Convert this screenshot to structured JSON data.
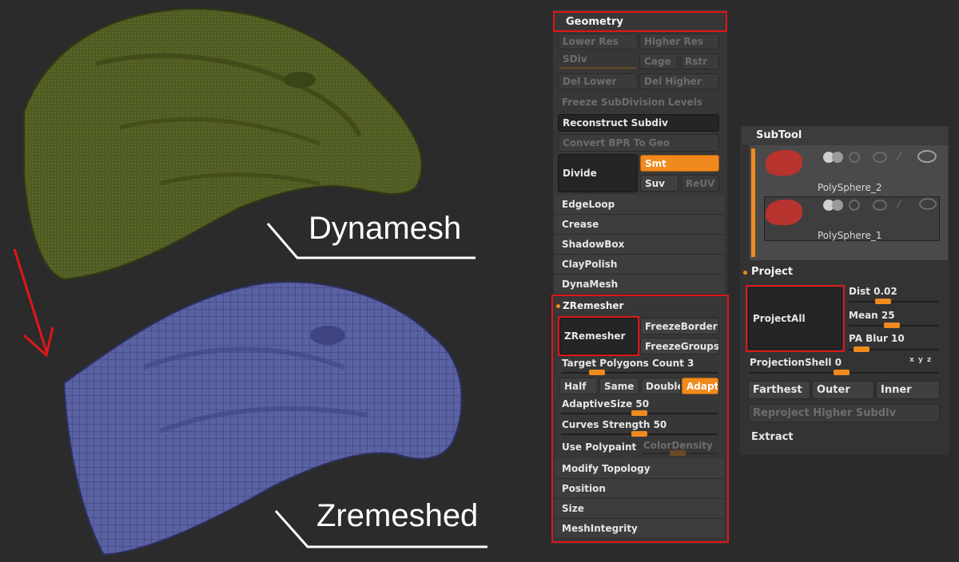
{
  "labels": {
    "dynamesh": "Dynamesh",
    "zremeshed": "Zremeshed"
  },
  "geometry": {
    "header": "Geometry",
    "lower_res": "Lower Res",
    "higher_res": "Higher Res",
    "sdiv": "SDiv",
    "cage": "Cage",
    "rstr": "Rstr",
    "del_lower": "Del Lower",
    "del_higher": "Del Higher",
    "freeze_subdivision": "Freeze SubDivision Levels",
    "reconstruct_subdiv": "Reconstruct Subdiv",
    "convert_bpr": "Convert BPR To Geo",
    "divide": "Divide",
    "smt": "Smt",
    "suv": "Suv",
    "reuv": "ReUV",
    "rows": [
      "EdgeLoop",
      "Crease",
      "ShadowBox",
      "ClayPolish",
      "DynaMesh"
    ]
  },
  "zremesher": {
    "header": "ZRemesher",
    "button": "ZRemesher",
    "freeze_border": "FreezeBorder",
    "freeze_groups": "FreezeGroups",
    "target_polygons": "Target Polygons Count 3",
    "target_polygons_value": 0.2,
    "half": "Half",
    "same": "Same",
    "double": "Double",
    "adapt": "Adapt",
    "adaptive_size": "AdaptiveSize 50",
    "adaptive_size_value": 0.5,
    "curves_strength": "Curves Strength 50",
    "curves_strength_value": 0.5,
    "use_polypaint": "Use Polypaint",
    "color_density": "ColorDensity",
    "rows": [
      "Modify Topology",
      "Position",
      "Size",
      "MeshIntegrity"
    ]
  },
  "subtool": {
    "header": "SubTool",
    "items": [
      "PolySphere_2",
      "PolySphere_1"
    ]
  },
  "project": {
    "header": "Project",
    "project_all": "ProjectAll",
    "dist": "Dist 0.02",
    "mean": "Mean 25",
    "pa_blur": "PA Blur 10",
    "projection_shell": "ProjectionShell 0",
    "xyz": "x y z",
    "farthest": "Farthest",
    "outer": "Outer",
    "inner": "Inner",
    "reproject": "Reproject Higher Subdiv",
    "extract": "Extract"
  },
  "colors": {
    "accent": "#f08a1e",
    "highlight_box": "#e01616",
    "dynamesh_model": "#4e5a22",
    "zremeshed_model": "#5a62a4"
  }
}
